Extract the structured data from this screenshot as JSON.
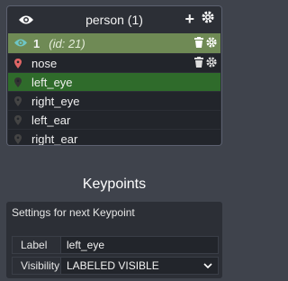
{
  "object": {
    "title": "person (1)",
    "instance": {
      "number": "1",
      "id_text": "(id: 21)"
    }
  },
  "keypoints": [
    {
      "label": "nose",
      "color": "#e06666",
      "selected": false,
      "show_icons": true
    },
    {
      "label": "left_eye",
      "color": "#333333",
      "selected": true,
      "show_icons": false
    },
    {
      "label": "right_eye",
      "color": "#444444",
      "selected": false,
      "show_icons": false
    },
    {
      "label": "left_ear",
      "color": "#444444",
      "selected": false,
      "show_icons": false
    },
    {
      "label": "right_ear",
      "color": "#444444",
      "selected": false,
      "show_icons": false
    }
  ],
  "section": {
    "title": "Keypoints",
    "subtitle": "Settings for next Keypoint",
    "label_field": {
      "label": "Label",
      "value": "left_eye"
    },
    "visibility_field": {
      "label": "Visibility",
      "value": "LABELED VISIBLE"
    }
  },
  "colors": {
    "selected_row": "#2f6b2b",
    "instance_row": "#6f8a55",
    "eye_active": "#6ec6c6"
  },
  "icons": [
    "eye-icon",
    "plus-icon",
    "gear-icon",
    "trash-icon",
    "map-pin-icon",
    "chevron-down-icon"
  ]
}
